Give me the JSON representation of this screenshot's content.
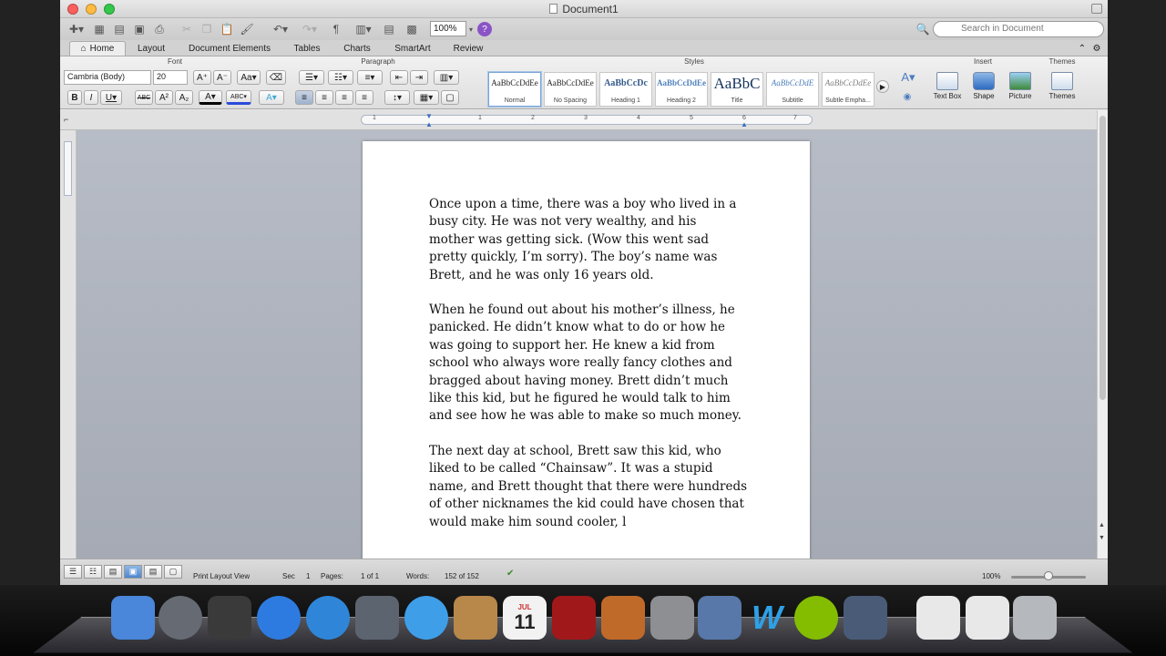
{
  "window": {
    "title": "Document1"
  },
  "search": {
    "placeholder": "Search in Document"
  },
  "toolbar": {
    "zoom": "100%"
  },
  "ribbon_tabs": [
    "Home",
    "Layout",
    "Document Elements",
    "Tables",
    "Charts",
    "SmartArt",
    "Review"
  ],
  "groups": {
    "font": "Font",
    "paragraph": "Paragraph",
    "styles": "Styles",
    "insert": "Insert",
    "themes": "Themes"
  },
  "font": {
    "name": "Cambria (Body)",
    "size": "20"
  },
  "styles": [
    {
      "preview": "AaBbCcDdEe",
      "name": "Normal"
    },
    {
      "preview": "AaBbCcDdEe",
      "name": "No Spacing"
    },
    {
      "preview": "AaBbCcDc",
      "name": "Heading 1"
    },
    {
      "preview": "AaBbCcDdEe",
      "name": "Heading 2"
    },
    {
      "preview": "AaBbC",
      "name": "Title"
    },
    {
      "preview": "AaBbCcDdE",
      "name": "Subtitle"
    },
    {
      "preview": "AaBbCcDdEe",
      "name": "Subtle Empha..."
    }
  ],
  "insert": {
    "text_box": "Text Box",
    "shape": "Shape",
    "picture": "Picture",
    "themes": "Themes"
  },
  "ruler": {
    "marks": [
      "1",
      "1",
      "2",
      "3",
      "4",
      "5",
      "6",
      "7"
    ]
  },
  "document": {
    "paragraphs": [
      "Once upon a time, there was a boy who lived in a\nbusy city. He was not very wealthy, and his\nmother was getting sick. (Wow this went sad\npretty quickly, I’m sorry). The boy’s name was\nBrett, and he was only 16 years old.",
      "When he found out about his mother’s illness, he\npanicked. He didn’t know what to do or how he\nwas going to support her. He knew a kid from\nschool who always wore really fancy clothes and\nbragged about having money. Brett didn’t much\nlike this kid, but he figured he would talk to him\nand see how he was able to make so much money.",
      "The next day at school, Brett saw this kid, who\nliked to be called “Chainsaw”. It was a stupid\nname, and Brett thought that there were hundreds\nof other nicknames the kid could have chosen that\nwould make him sound cooler, l"
    ]
  },
  "status": {
    "view": "Print Layout View",
    "sec_label": "Sec",
    "sec_value": "1",
    "pages_label": "Pages:",
    "pages_value": "1 of 1",
    "words_label": "Words:",
    "words_value": "152 of 152",
    "zoom": "100%"
  },
  "dock": {
    "apps": [
      {
        "icon": "finder-icon",
        "color": "#4a86d9"
      },
      {
        "icon": "launchpad-icon",
        "color": "#666a73"
      },
      {
        "icon": "photo-booth-icon",
        "color": "#3a3a3a"
      },
      {
        "icon": "app-store-icon",
        "color": "#2d7be0"
      },
      {
        "icon": "safari-icon",
        "color": "#2f86d8"
      },
      {
        "icon": "facetime-icon",
        "color": "#5c6470"
      },
      {
        "icon": "itunes-icon",
        "color": "#3f9ee8"
      },
      {
        "icon": "contacts-icon",
        "color": "#b8874a"
      },
      {
        "icon": "calendar-icon",
        "color": "#f2f2f2"
      },
      {
        "icon": "photo-booth-strip-icon",
        "color": "#a0181a"
      },
      {
        "icon": "iphoto-icon",
        "color": "#c06a2a"
      },
      {
        "icon": "system-preferences-icon",
        "color": "#8d8f93"
      },
      {
        "icon": "preview-icon",
        "color": "#5778a8"
      },
      {
        "icon": "word-w-icon",
        "color": "#2ea0e6"
      },
      {
        "icon": "spotify-icon",
        "color": "#84bd00"
      },
      {
        "icon": "imovie-icon",
        "color": "#4a5b78"
      },
      {
        "icon": "pdf-document-icon",
        "color": "#e8e8e8"
      },
      {
        "icon": "document-icon",
        "color": "#e8e8e8"
      },
      {
        "icon": "trash-icon",
        "color": "#b5b8bd"
      }
    ],
    "calendar_month": "JUL",
    "calendar_day": "11",
    "w_letter": "W"
  }
}
